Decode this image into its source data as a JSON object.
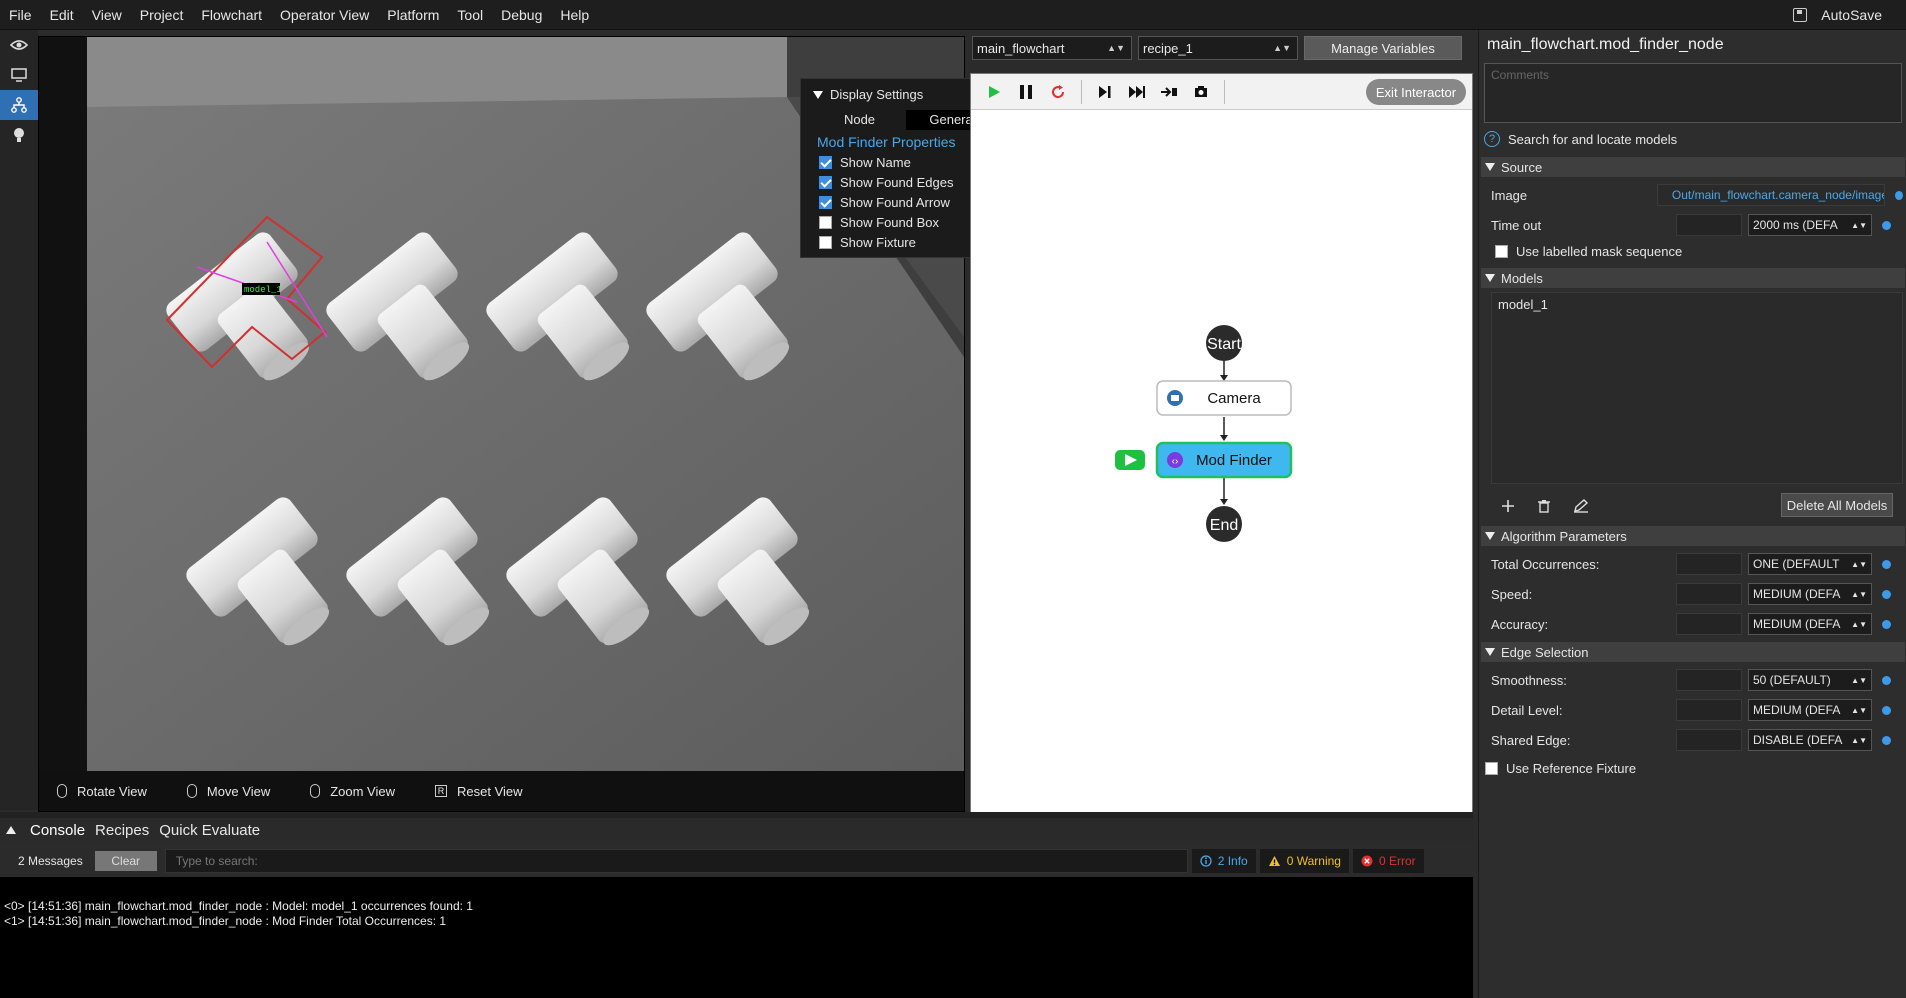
{
  "menu": [
    "File",
    "Edit",
    "View",
    "Project",
    "Flowchart",
    "Operator View",
    "Platform",
    "Tool",
    "Debug",
    "Help"
  ],
  "autosave_label": "AutoSave",
  "display_settings": {
    "title": "Display Settings",
    "tabs": [
      "Node",
      "General"
    ],
    "selected_tab": "General",
    "subtitle": "Mod Finder Properties",
    "options": [
      {
        "label": "Show Name",
        "checked": true
      },
      {
        "label": "Show Found Edges",
        "checked": true
      },
      {
        "label": "Show Found Arrow",
        "checked": true
      },
      {
        "label": "Show Found Box",
        "checked": false
      },
      {
        "label": "Show Fixture",
        "checked": false
      }
    ]
  },
  "overlay_label": "model_1",
  "view_hints": [
    "Rotate View",
    "Move View",
    "Zoom View",
    "Reset View"
  ],
  "view_hint_key": "R",
  "flowchart": {
    "selected_flowchart": "main_flowchart",
    "selected_recipe": "recipe_1",
    "manage_variables": "Manage Variables",
    "exit_interactor": "Exit Interactor",
    "nodes": {
      "start": "Start",
      "camera": "Camera",
      "mod_finder": "Mod Finder",
      "end": "End"
    }
  },
  "panel": {
    "title": "main_flowchart.mod_finder_node",
    "comments_placeholder": "Comments",
    "description": "Search for and locate models",
    "source_section": "Source",
    "image_label": "Image",
    "image_value": "Out/main_flowchart.camera_node/image",
    "timeout_label": "Time out",
    "timeout_value": "2000 ms (DEFA",
    "use_mask_label": "Use labelled mask sequence",
    "models_section": "Models",
    "models": [
      "model_1"
    ],
    "delete_all": "Delete All Models",
    "algo_section": "Algorithm Parameters",
    "algo_params": [
      {
        "label": "Total Occurrences:",
        "value": "ONE (DEFAULT"
      },
      {
        "label": "Speed:",
        "value": "MEDIUM (DEFA"
      },
      {
        "label": "Accuracy:",
        "value": "MEDIUM (DEFA"
      }
    ],
    "edge_section": "Edge Selection",
    "edge_params": [
      {
        "label": "Smoothness:",
        "value": "50 (DEFAULT)"
      },
      {
        "label": "Detail Level:",
        "value": "MEDIUM (DEFA"
      },
      {
        "label": "Shared Edge:",
        "value": "DISABLE (DEFA"
      }
    ],
    "use_fixture_label": "Use Reference Fixture"
  },
  "console": {
    "tabs": [
      "Console",
      "Recipes",
      "Quick Evaluate"
    ],
    "message_count": "2 Messages",
    "clear": "Clear",
    "search_placeholder": "Type to search:",
    "info": "2 Info",
    "warning": "0 Warning",
    "error": "0 Error",
    "lines": [
      "<0> [14:51:36] main_flowchart.mod_finder_node : Model: model_1 occurrences found: 1",
      "<1> [14:51:36] main_flowchart.mod_finder_node : Mod Finder Total Occurrences: 1"
    ]
  },
  "colors": {
    "accent": "#2f6fb3",
    "link": "#4aa8e8",
    "mod_finder_node": "#3fb8f0",
    "mod_finder_border": "#20c060",
    "run_green": "#1ec040",
    "stop_red": "#e03030",
    "warning": "#f0c020"
  }
}
